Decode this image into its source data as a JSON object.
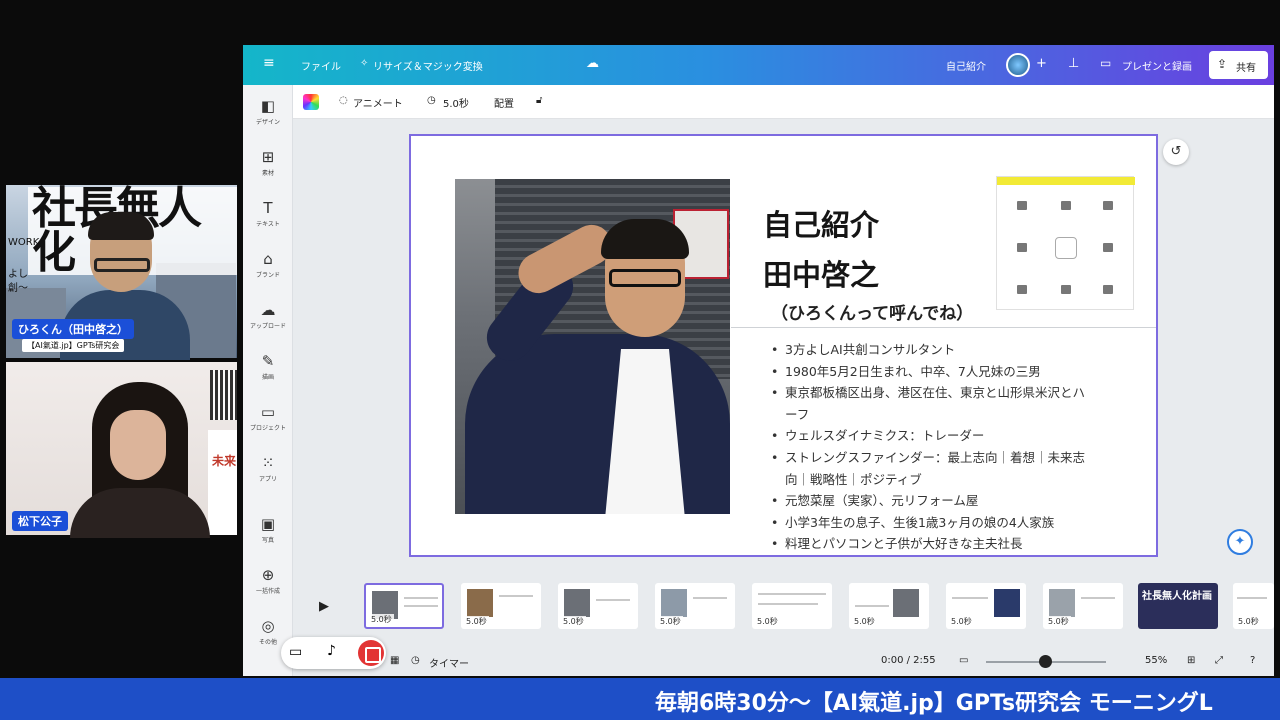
{
  "participants": [
    {
      "name": "ひろくん（田中啓之）",
      "subtitle": "【AI氣道.jp】GPTs研究会",
      "poster_text": "社長無人化",
      "poster_small_1": "WORK",
      "poster_small_2": "よし",
      "poster_small_3": "創～"
    },
    {
      "name": "松下公子",
      "flyer_text": "未来"
    }
  ],
  "canva": {
    "topbar": {
      "menu_icon": "menu-icon",
      "file": "ファイル",
      "resize": "リサイズ＆マジック変換",
      "doc_title": "自己紹介",
      "add_member": "+",
      "present": "プレゼンと録画",
      "share": "共有"
    },
    "sidebar": [
      {
        "icon": "design-icon",
        "label": "デザイン"
      },
      {
        "icon": "elements-icon",
        "label": "素材"
      },
      {
        "icon": "text-icon",
        "label": "テキスト"
      },
      {
        "icon": "brand-icon",
        "label": "ブランド"
      },
      {
        "icon": "upload-icon",
        "label": "アップロード"
      },
      {
        "icon": "draw-icon",
        "label": "描画"
      },
      {
        "icon": "project-icon",
        "label": "プロジェクト"
      },
      {
        "icon": "apps-icon",
        "label": "アプリ"
      },
      {
        "icon": "photo-icon",
        "label": "写真"
      },
      {
        "icon": "bulk-icon",
        "label": "一括作成"
      },
      {
        "icon": "more-icon",
        "label": "その他"
      }
    ],
    "toolbar": {
      "animate": "アニメート",
      "duration": "5.0秒",
      "position": "配置"
    },
    "slide": {
      "title1": "自己紹介",
      "title2": "田中啓之",
      "subtitle": "（ひろくんって呼んでね）",
      "bullets": [
        "3方よしAI共創コンサルタント",
        "1980年5月2日生まれ、中卒、7人兄妹の三男",
        "東京都板橋区出身、港区在住、東京と山形県米沢とハーフ",
        "ウェルスダイナミクス：トレーダー",
        "ストレングスファインダー：最上志向｜着想｜未来志向｜戦略性｜ポジティブ",
        "元惣菜屋（実家）、元リフォーム屋",
        "小学3年生の息子、生後1歳3ヶ月の娘の4人家族",
        "料理とパソコンと子供が大好きな主夫社長"
      ]
    },
    "filmstrip": {
      "durations": [
        "5.0秒",
        "5.0秒",
        "5.0秒",
        "5.0秒",
        "5.0秒",
        "5.0秒",
        "5.0秒",
        "5.0秒",
        "5.0秒",
        "5.0秒"
      ],
      "dark_thumb_text": "社長無人化計画"
    },
    "bottombar": {
      "timer": "タイマー",
      "time": "0:00 / 2:55",
      "zoom": "55%",
      "zoom_level": 0.55
    }
  },
  "banner": "毎朝6時30分～【AI氣道.jp】GPTs研究会 モーニングL",
  "colors": {
    "banner": "#1e4fc7",
    "name_tag": "#1b4fd8",
    "slide_border": "#7d6be0",
    "record": "#e23434"
  }
}
